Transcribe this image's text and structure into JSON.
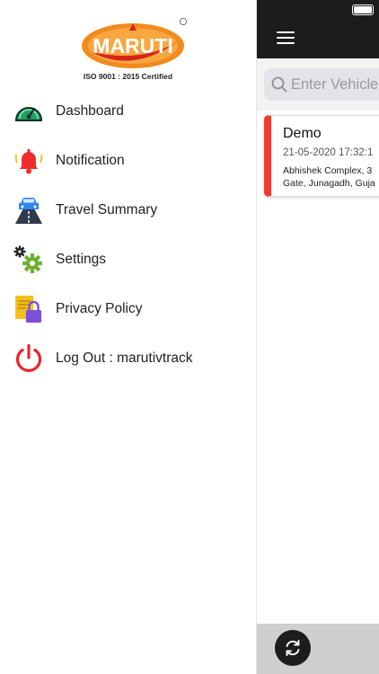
{
  "drawer": {
    "logo_text": "MARUTI",
    "iso": "ISO 9001 : 2015 Certified",
    "items": [
      {
        "label": "Dashboard",
        "icon": "speedometer-icon"
      },
      {
        "label": "Notification",
        "icon": "bell-icon"
      },
      {
        "label": "Travel Summary",
        "icon": "car-road-icon"
      },
      {
        "label": "Settings",
        "icon": "gears-icon"
      },
      {
        "label": "Privacy Policy",
        "icon": "document-lock-icon"
      },
      {
        "label": "Log Out : marutivtrack",
        "icon": "power-icon"
      }
    ]
  },
  "main": {
    "search": {
      "placeholder": "Enter Vehicle"
    },
    "vehicle_card": {
      "name": "Demo",
      "datetime": "21-05-2020 17:32:1",
      "address_line1": "Abhishek Complex, 3",
      "address_line2": "Gate, Junagadh, Guja"
    }
  },
  "colors": {
    "topbar": "#1c1c1c",
    "card_accent": "#f03c30",
    "logo_orange": "#f28a1e",
    "logo_red": "#d8231c"
  }
}
